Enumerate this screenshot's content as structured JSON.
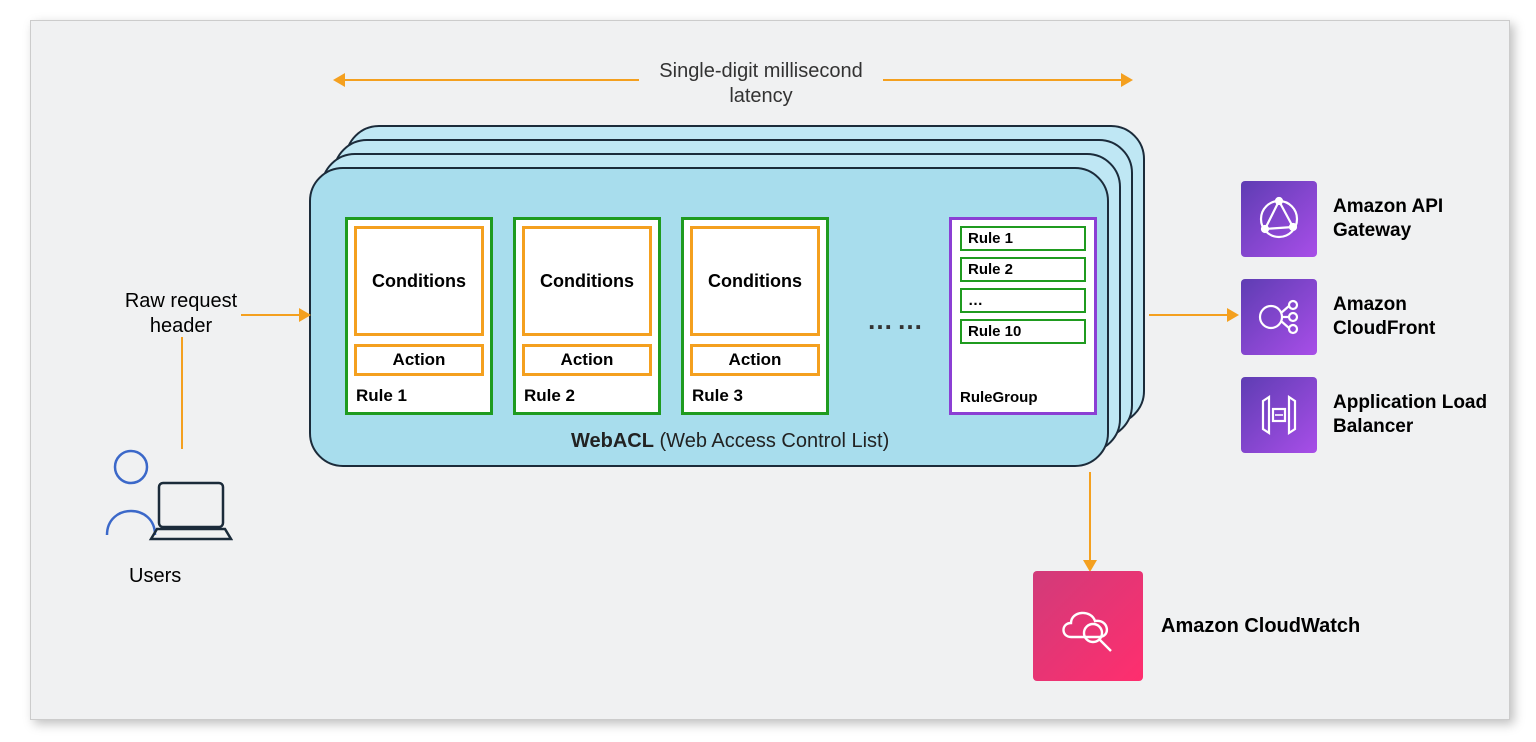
{
  "latency_label": "Single-digit millisecond latency",
  "request_label": "Raw request header",
  "users_label": "Users",
  "webacl_bold": "WebACL",
  "webacl_rest": " (Web Access Control List)",
  "rules": [
    {
      "cond": "Conditions",
      "act": "Action",
      "label": "Rule 1"
    },
    {
      "cond": "Conditions",
      "act": "Action",
      "label": "Rule 2"
    },
    {
      "cond": "Conditions",
      "act": "Action",
      "label": "Rule 3"
    }
  ],
  "dots": "……",
  "rulegroup": {
    "items": [
      "Rule 1",
      "Rule 2",
      "…",
      "Rule 10"
    ],
    "label": "RuleGroup"
  },
  "services": [
    {
      "label": "Amazon API Gateway"
    },
    {
      "label": "Amazon CloudFront"
    },
    {
      "label": "Application Load Balancer"
    }
  ],
  "cloudwatch_label": "Amazon CloudWatch"
}
